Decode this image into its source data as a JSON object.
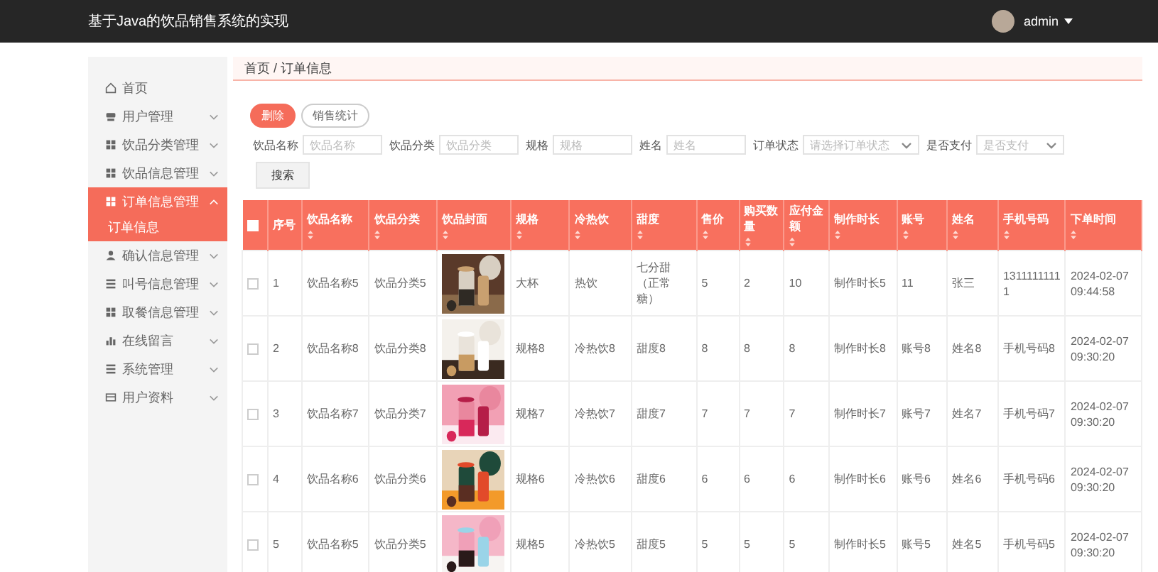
{
  "header": {
    "title": "基于Java的饮品销售系统的实现",
    "user": "admin"
  },
  "sidebar": {
    "items": [
      {
        "label": "首页",
        "selected": false
      },
      {
        "label": "用户管理",
        "selected": false,
        "expanded": false
      },
      {
        "label": "饮品分类管理",
        "selected": false,
        "expanded": false
      },
      {
        "label": "饮品信息管理",
        "selected": false,
        "expanded": false
      },
      {
        "label": "订单信息管理",
        "selected": true,
        "expanded": true,
        "children": [
          {
            "label": "订单信息",
            "selected": true
          }
        ]
      },
      {
        "label": "确认信息管理",
        "selected": false,
        "expanded": false
      },
      {
        "label": "叫号信息管理",
        "selected": false,
        "expanded": false
      },
      {
        "label": "取餐信息管理",
        "selected": false,
        "expanded": false
      },
      {
        "label": "在线留言",
        "selected": false,
        "expanded": false
      },
      {
        "label": "系统管理",
        "selected": false,
        "expanded": false
      },
      {
        "label": "用户资料",
        "selected": false,
        "expanded": false
      }
    ]
  },
  "breadcrumb": "首页 / 订单信息",
  "actions": [
    {
      "label": "删除",
      "kind": "primary"
    },
    {
      "label": "销售统计",
      "kind": "outline"
    }
  ],
  "filters": [
    {
      "label": "饮品名称",
      "placeholder": "饮品名称",
      "kind": "input"
    },
    {
      "label": "饮品分类",
      "placeholder": "饮品分类",
      "kind": "input"
    },
    {
      "label": "规格",
      "placeholder": "规格",
      "kind": "input"
    },
    {
      "label": "姓名",
      "placeholder": "姓名",
      "kind": "input"
    },
    {
      "label": "订单状态",
      "placeholder": "请选择订单状态",
      "kind": "select"
    },
    {
      "label": "是否支付",
      "placeholder": "是否支付",
      "kind": "select"
    }
  ],
  "search_button": "搜索",
  "table": {
    "header_checked": false,
    "columns": [
      {
        "label": "序号",
        "sortable": false
      },
      {
        "label": "饮品名称",
        "sortable": true
      },
      {
        "label": "饮品分类",
        "sortable": true
      },
      {
        "label": "饮品封面",
        "sortable": true
      },
      {
        "label": "规格",
        "sortable": true
      },
      {
        "label": "冷热饮",
        "sortable": true
      },
      {
        "label": "甜度",
        "sortable": true
      },
      {
        "label": "售价",
        "sortable": true
      },
      {
        "label": "购买数量",
        "sortable": true
      },
      {
        "label": "应付金额",
        "sortable": true
      },
      {
        "label": "制作时长",
        "sortable": true
      },
      {
        "label": "账号",
        "sortable": true
      },
      {
        "label": "姓名",
        "sortable": true
      },
      {
        "label": "手机号码",
        "sortable": true
      },
      {
        "label": "下单时间",
        "sortable": true
      }
    ],
    "rows": [
      {
        "checked": false,
        "cells": [
          "1",
          "饮品名称5",
          "饮品分类5",
          {
            "kind": "picture"
          },
          "大杯",
          "热饮",
          "七分甜（正常糖）",
          "5",
          "2",
          "10",
          "制作时长5",
          "11",
          "张三",
          "13111111111",
          "2024-02-07 09:44:58"
        ]
      },
      {
        "checked": false,
        "cells": [
          "2",
          "饮品名称8",
          "饮品分类8",
          {
            "kind": "picture"
          },
          "规格8",
          "冷热饮8",
          "甜度8",
          "8",
          "8",
          "8",
          "制作时长8",
          "账号8",
          "姓名8",
          "手机号码8",
          "2024-02-07 09:30:20"
        ]
      },
      {
        "checked": false,
        "cells": [
          "3",
          "饮品名称7",
          "饮品分类7",
          {
            "kind": "picture"
          },
          "规格7",
          "冷热饮7",
          "甜度7",
          "7",
          "7",
          "7",
          "制作时长7",
          "账号7",
          "姓名7",
          "手机号码7",
          "2024-02-07 09:30:20"
        ]
      },
      {
        "checked": false,
        "cells": [
          "4",
          "饮品名称6",
          "饮品分类6",
          {
            "kind": "picture"
          },
          "规格6",
          "冷热饮6",
          "甜度6",
          "6",
          "6",
          "6",
          "制作时长6",
          "账号6",
          "姓名6",
          "手机号码6",
          "2024-02-07 09:30:20"
        ]
      },
      {
        "checked": false,
        "cells": [
          "5",
          "饮品名称5",
          "饮品分类5",
          {
            "kind": "picture"
          },
          "规格5",
          "冷热饮5",
          "甜度5",
          "5",
          "5",
          "5",
          "制作时长5",
          "账号5",
          "姓名5",
          "手机号码5",
          "2024-02-07 09:30:20"
        ]
      }
    ]
  }
}
